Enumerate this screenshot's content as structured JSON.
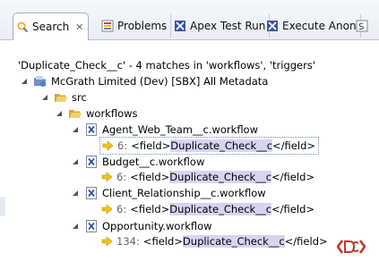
{
  "tabs": [
    {
      "label": "Search",
      "icon": "search-icon",
      "active": true,
      "closable": true
    },
    {
      "label": "Problems",
      "icon": "problems-icon",
      "active": false,
      "closable": false
    },
    {
      "label": "Apex Test Run",
      "icon": "apex-test-run-icon",
      "active": false,
      "closable": false
    },
    {
      "label": "Execute Anon",
      "icon": "execute-anonymous-icon",
      "active": false,
      "closable": false
    }
  ],
  "search": {
    "summary": "'Duplicate_Check__c' - 4 matches in 'workflows', 'triggers'"
  },
  "tree": {
    "project": "McGrath Limited (Dev) [SBX] All Metadata",
    "src_folder": "src",
    "workflows_folder": "workflows",
    "files": [
      {
        "name": "Agent_Web_Team__c.workflow",
        "line": "6:",
        "pre": "<field>",
        "match": "Duplicate_Check__c",
        "post": "</field>",
        "selected": true
      },
      {
        "name": "Budget__c.workflow",
        "line": "6:",
        "pre": "<field>",
        "match": "Duplicate_Check__c",
        "post": "</field>",
        "selected": false
      },
      {
        "name": "Client_Relationship__c.workflow",
        "line": "6:",
        "pre": "<field>",
        "match": "Duplicate_Check__c",
        "post": "</field>",
        "selected": false
      },
      {
        "name": "Opportunity.workflow",
        "line": "134:",
        "pre": "<field>",
        "match": "Duplicate_Check__c",
        "post": "</field>",
        "selected": false
      }
    ]
  },
  "colors": {
    "tab_accent": "#e8c02a",
    "match_highlight": "#d7d4f2",
    "arrow_yellow": "#f0c419",
    "folder_yellow": "#e9b949"
  }
}
